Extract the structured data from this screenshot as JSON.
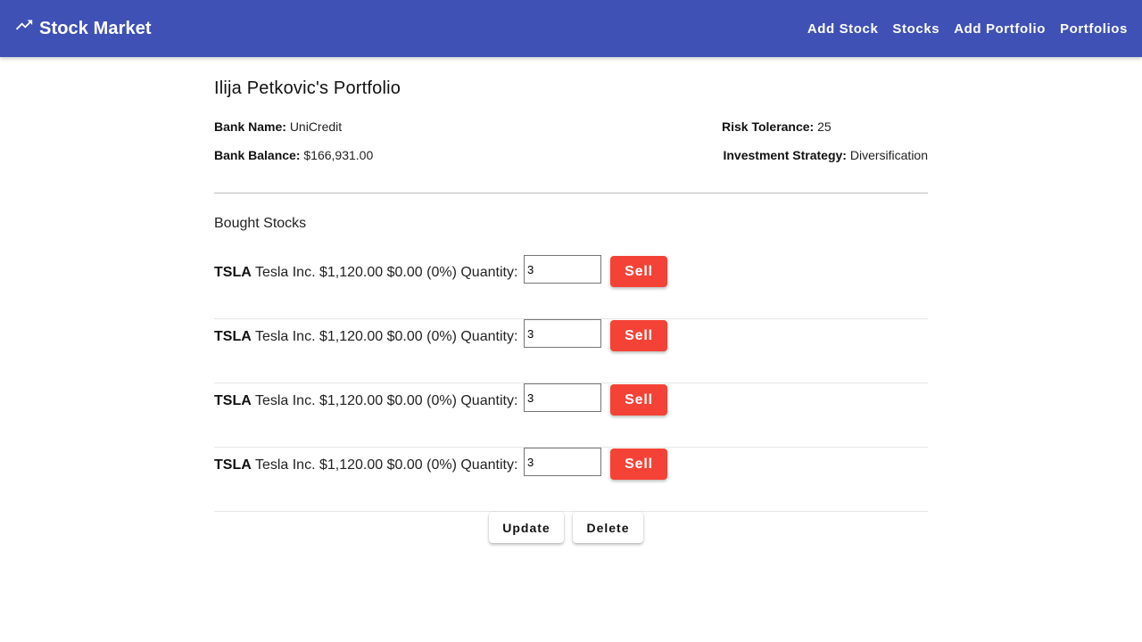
{
  "app": {
    "title": "Stock Market",
    "icon": "trending-up-icon",
    "colors": {
      "primary": "#3f51b5",
      "warn": "#f44336"
    }
  },
  "nav": {
    "items": [
      {
        "label": "Add Stock"
      },
      {
        "label": "Stocks"
      },
      {
        "label": "Add Portfolio"
      },
      {
        "label": "Portfolios"
      }
    ]
  },
  "portfolio": {
    "title": "Ilija Petkovic's Portfolio",
    "bank_name_label": "Bank Name:",
    "bank_name": "UniCredit",
    "bank_balance_label": "Bank Balance:",
    "bank_balance": "$166,931.00",
    "risk_label": "Risk Tolerance:",
    "risk": "25",
    "strategy_label": "Investment Strategy:",
    "strategy": "Diversification"
  },
  "stocks": {
    "section_title": "Bought Stocks",
    "quantity_label": "Quantity:",
    "sell_label": "Sell",
    "items": [
      {
        "symbol": "TSLA",
        "name": "Tesla Inc.",
        "price": "$1,120.00",
        "change": "$0.00",
        "change_pct": "(0%)",
        "quantity": "3"
      },
      {
        "symbol": "TSLA",
        "name": "Tesla Inc.",
        "price": "$1,120.00",
        "change": "$0.00",
        "change_pct": "(0%)",
        "quantity": "3"
      },
      {
        "symbol": "TSLA",
        "name": "Tesla Inc.",
        "price": "$1,120.00",
        "change": "$0.00",
        "change_pct": "(0%)",
        "quantity": "3"
      },
      {
        "symbol": "TSLA",
        "name": "Tesla Inc.",
        "price": "$1,120.00",
        "change": "$0.00",
        "change_pct": "(0%)",
        "quantity": "3"
      }
    ]
  },
  "actions": {
    "update_label": "Update",
    "delete_label": "Delete"
  }
}
